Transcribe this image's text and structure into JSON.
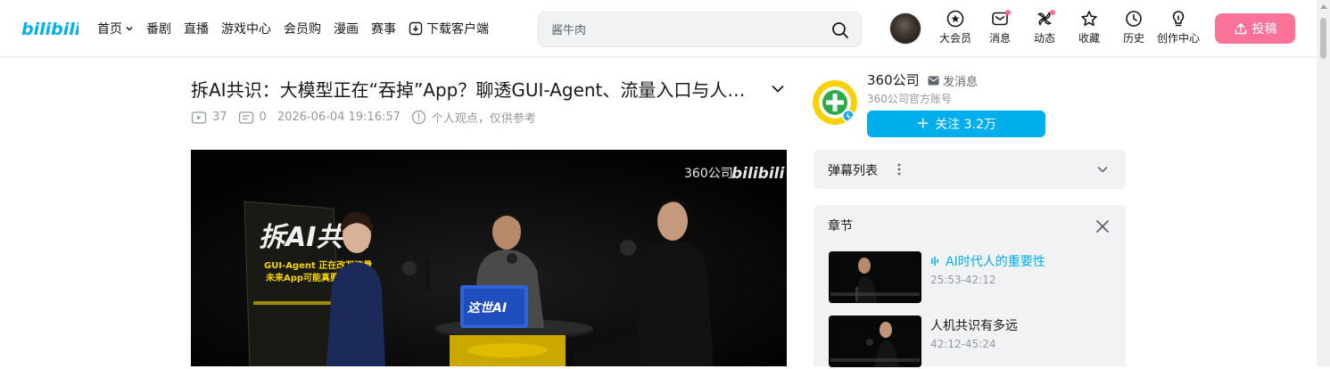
{
  "header": {
    "logo_text": "bilibili",
    "nav": [
      {
        "label": "首页",
        "dropdown": true
      },
      {
        "label": "番剧"
      },
      {
        "label": "直播"
      },
      {
        "label": "游戏中心"
      },
      {
        "label": "会员购"
      },
      {
        "label": "漫画"
      },
      {
        "label": "赛事"
      },
      {
        "label": "下载客户端"
      }
    ],
    "search_placeholder": "酱牛肉",
    "icons": [
      {
        "label": "大会员",
        "icon": "vip-icon",
        "dot": false
      },
      {
        "label": "消息",
        "icon": "message-icon",
        "dot": true
      },
      {
        "label": "动态",
        "icon": "dynamic-icon",
        "dot": true
      },
      {
        "label": "收藏",
        "icon": "star-icon",
        "dot": false
      },
      {
        "label": "历史",
        "icon": "clock-icon",
        "dot": false
      },
      {
        "label": "创作中心",
        "icon": "bulb-icon",
        "dot": false
      }
    ],
    "upload_label": "投稿"
  },
  "video": {
    "title": "拆AI共识：大模型正在“吞掉”App？聊透GUI-Agent、流量入口与人机共识",
    "plays": "37",
    "danmaku_count": "0",
    "date": "2026-06-04 19:16:57",
    "notice": "个人观点，仅供参考",
    "watermark_brand": "360公司",
    "watermark_logo": "bilibili",
    "poster_title": "拆AI共识",
    "poster_sub1": "GUI-Agent 正在改写流量",
    "poster_sub2": "未来App可能真要",
    "sign_text": "这世AI"
  },
  "uploader": {
    "name": "360公司",
    "message_label": "发消息",
    "desc": "360公司官方账号",
    "follow_label": "关注 3.2万"
  },
  "danmaku_list": {
    "label": "弹幕列表"
  },
  "chapters": {
    "title": "章节",
    "items": [
      {
        "title": "AI时代人的重要性",
        "time": "25:53-42:12",
        "active": true
      },
      {
        "title": "人机共识有多远",
        "time": "42:12-45:24",
        "active": false
      }
    ]
  },
  "colors": {
    "brand_blue": "#00aeec",
    "brand_pink": "#fb7299",
    "panel_bg": "#f1f2f3"
  }
}
